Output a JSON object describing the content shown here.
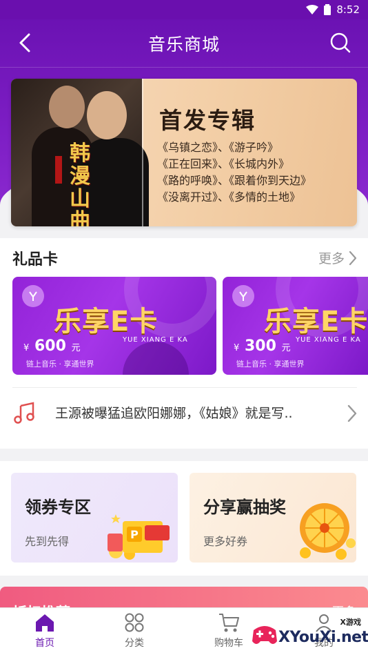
{
  "status_bar": {
    "time": "8:52"
  },
  "nav": {
    "title": "音乐商城"
  },
  "banner": {
    "calligraphy": "韩漫山曲",
    "title": "首发专辑",
    "lines": [
      "《乌镇之恋》、《游子吟》",
      "《正在回来》、《长城内外》",
      "《路的呼唤》、《跟着你到天边》",
      "《没离开过》、《多情的土地》"
    ]
  },
  "gift": {
    "title": "礼品卡",
    "more": "更多",
    "cards": [
      {
        "title": "乐享E卡",
        "subtitle": "YUE XIANG E KA",
        "currency": "¥",
        "amount": "600",
        "unit": "元",
        "slogan": "链上音乐 · 享通世界"
      },
      {
        "title": "乐享E卡",
        "subtitle": "YUE XIANG E KA",
        "currency": "¥",
        "amount": "300",
        "unit": "元",
        "slogan": "链上音乐 · 享通世界"
      }
    ]
  },
  "news": {
    "text": "王源被曝猛追欧阳娜娜，《姑娘》就是写.."
  },
  "promos": [
    {
      "title": "领券专区",
      "subtitle": "先到先得"
    },
    {
      "title": "分享赢抽奖",
      "subtitle": "更多好券"
    }
  ],
  "next_section": {
    "title": "折扣推荐",
    "more": "更多"
  },
  "tabs": [
    {
      "label": "首页"
    },
    {
      "label": "分类"
    },
    {
      "label": "购物车"
    },
    {
      "label": "我的"
    }
  ],
  "watermark": {
    "text": "XYouXi.net",
    "small": "X游戏"
  },
  "colors": {
    "primary": "#6b12b3",
    "gold": "#ffd566",
    "red_accent": "#e05050"
  }
}
